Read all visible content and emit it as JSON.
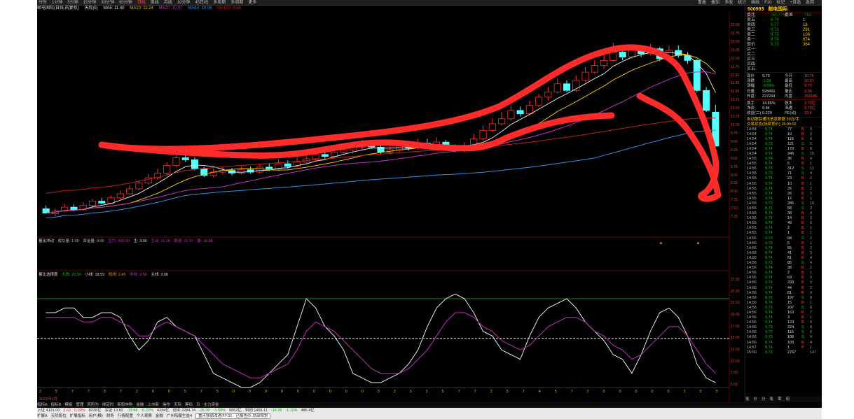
{
  "toolbar": {
    "period_tabs": [
      "分时",
      "1分钟",
      "5分钟",
      "15分钟",
      "30分钟",
      "60分钟",
      "日线",
      "周线",
      "月线",
      "10分钟",
      "45日线",
      "多周期",
      "多周期",
      "更多"
    ],
    "selected_period": "日线",
    "right_tools": [
      "重叠",
      "叠加",
      "多股",
      "统计",
      "画线",
      "F10",
      "标记",
      "+自选",
      "返回"
    ]
  },
  "info_row": {
    "stock": "邮电国际(日线,前复权)",
    "ma_label": "天际(5)",
    "items": [
      "MA5: 11.40",
      "MA10: 11.24",
      "MA20: 10.97",
      "MA60: 10.08",
      "MA120: 9.95"
    ]
  },
  "price_axis": [
    "13.00",
    "12.75",
    "12.50",
    "12.25",
    "12.00",
    "11.75",
    "11.50",
    "11.25",
    "11.00",
    "10.75",
    "10.50",
    "10.25",
    "10.00",
    "9.75",
    "9.50",
    "9.25",
    "9.00",
    "8.75",
    "8.50",
    "8.25",
    "8.00",
    "7.75",
    "7.50",
    "7.25"
  ],
  "indicator1": {
    "name": "量比冲动",
    "params": [
      "成交量: 1.00",
      "资金量: 0.00",
      "主力: 420.00",
      "主: 3.00",
      "主动: 11.18",
      "跟进: 11.70",
      "量: 18.88"
    ]
  },
  "indicator2": {
    "name": "量比选择度",
    "params": [
      "大线: 20.00",
      "小线: 18.59",
      "短线: 2.45",
      "中线: 9.66",
      "主线: 3.00"
    ]
  },
  "ind_axis": [
    "27.50",
    "25.00",
    "22.50",
    "20.00",
    "17.50",
    "15.00",
    "12.50",
    "10.00",
    "7.50",
    "5.00"
  ],
  "xaxis_values": "2 5 7 7 5 7 2 0 0 5 7 5 0 0 0 0 0 0 0 0 0 5 2 5 2 5 7 7 2 5 7 4 5 7 2 0 0 0 0 0 2 0 5 7 0 2 0 2 0 2 7 0 0 0 0 0 0 7 0 2 0 0 5 0 0 0 6 2 0 0 0 0",
  "xaxis_date": "2023年1月",
  "bottom_tabs": [
    "指标A",
    "指标B",
    "模板",
    "管理",
    "风险为",
    "绑定时",
    "新股申购",
    "金融",
    "上市新",
    "操作",
    "天际",
    "筹码",
    "日",
    "主力资金"
  ],
  "status_bar": {
    "row1": [
      "上证 4131.00",
      "3.62",
      "0.09%",
      "8226亿",
      "深证 13.82",
      "-13.48",
      "-0.22%",
      "4334亿",
      "创业 2284.74",
      "-35.00",
      "-1.08%",
      "5652亿",
      "科创 1455.11",
      "-16.39",
      "-1.11%",
      "486.4亿"
    ],
    "row2": [
      "扩展A",
      "天阶段位",
      "扩展指标",
      "用户(模)",
      "财务",
      "行情配置",
      "个人观察",
      "金融",
      "广州院服生益4"
    ],
    "input_text": "重点强调改进/FY.01 · 已报告价·总部规划"
  },
  "right_panel": {
    "stock_code": "600993",
    "stock_name": "邮电国际",
    "webi": {
      "label": "委比",
      "value": "-50.77%",
      "label2": "委差",
      "value2": "-782"
    },
    "sells": [
      {
        "label": "卖五",
        "price": "9.78",
        "vol": "1"
      },
      {
        "label": "卖四",
        "price": "9.77",
        "vol": "18"
      },
      {
        "label": "卖三",
        "price": "9.76",
        "vol": "291"
      },
      {
        "label": "卖二",
        "price": "9.75",
        "vol": "108"
      },
      {
        "label": "卖一",
        "price": "9.74",
        "vol": "674"
      }
    ],
    "current": {
      "label": "现价",
      "price": "9.73",
      "vol": "364"
    },
    "buys": [
      {
        "label": "买一",
        "price": "",
        "vol": ""
      },
      {
        "label": "买二",
        "price": "",
        "vol": ""
      },
      {
        "label": "买三",
        "price": "",
        "vol": ""
      },
      {
        "label": "买四",
        "price": "",
        "vol": ""
      },
      {
        "label": "买五",
        "price": "",
        "vol": ""
      }
    ],
    "stats": [
      {
        "l1": "现价",
        "v1": "9.73",
        "l2": "今开",
        "v2": "10.75"
      },
      {
        "l1": "涨跌",
        "v1": "-1.08",
        "l2": "最高",
        "v2": "10.97"
      },
      {
        "l1": "涨幅",
        "v1": "-9.99%",
        "l2": "最低",
        "v2": "9.73"
      },
      {
        "l1": "总量",
        "v1": "528460",
        "l2": "量比",
        "v2": "3.09"
      },
      {
        "l1": "外盘",
        "v1": "227234",
        "l2": "内盘",
        "v2": "293186"
      }
    ],
    "stats2": [
      {
        "l1": "换手",
        "v1": "14.86%",
        "l2": "股本",
        "v2": "3.70亿"
      },
      {
        "l1": "净资",
        "v1": "9.84",
        "l2": "流通",
        "v2": "3.70亿"
      },
      {
        "l1": "收益(二)",
        "v1": "0.220",
        "l2": "PE(动)",
        "v2": "33.4"
      }
    ],
    "fund_line1": "自动跟踪通讯信息数据 30万/手",
    "fund_line2": "交易状态(持续竞价) 15:00:02",
    "ticks": [
      {
        "t": "14:54",
        "p": "9.74",
        "v": "77",
        "d": "B",
        "n": "3"
      },
      {
        "t": "14:54",
        "p": "9.74",
        "v": "10",
        "d": "B",
        "n": "2"
      },
      {
        "t": "14:54",
        "p": "9.74",
        "v": "118",
        "d": "B",
        "n": "6"
      },
      {
        "t": "14:54",
        "p": "9.73",
        "v": "121",
        "d": "S",
        "n": "5"
      },
      {
        "t": "14:54",
        "p": "9.74",
        "v": "170",
        "d": "B",
        "n": "8"
      },
      {
        "t": "14:54",
        "p": "9.74",
        "v": "346",
        "d": "S",
        "n": "15"
      },
      {
        "t": "14:55",
        "p": "9.74",
        "v": "36",
        "d": "B",
        "n": "4"
      },
      {
        "t": "14:55",
        "p": "9.74",
        "v": "5",
        "d": "B",
        "n": "1"
      },
      {
        "t": "14:55",
        "p": "9.73",
        "v": "312",
        "d": "S",
        "n": "11"
      },
      {
        "t": "14:55",
        "p": "9.73",
        "v": "71",
        "d": "S",
        "n": "4"
      },
      {
        "t": "14:55",
        "p": "9.74",
        "v": "23",
        "d": "B",
        "n": "2"
      },
      {
        "t": "14:55",
        "p": "9.74",
        "v": "10",
        "d": "B",
        "n": "1"
      },
      {
        "t": "14:55",
        "p": "9.74",
        "v": "25",
        "d": "B",
        "n": "2"
      },
      {
        "t": "14:55",
        "p": "9.74",
        "v": "26",
        "d": "B",
        "n": "2"
      },
      {
        "t": "14:55",
        "p": "9.74",
        "v": "12",
        "d": "B",
        "n": "1"
      },
      {
        "t": "14:55",
        "p": "9.73",
        "v": "285",
        "d": "S",
        "n": "10"
      },
      {
        "t": "14:55",
        "p": "9.73",
        "v": "58",
        "d": "S",
        "n": "3"
      },
      {
        "t": "14:55",
        "p": "9.74",
        "v": "38",
        "d": "B",
        "n": "4"
      },
      {
        "t": "14:55",
        "p": "9.74",
        "v": "14",
        "d": "B",
        "n": "2"
      },
      {
        "t": "14:55",
        "p": "9.74",
        "v": "49",
        "d": "B",
        "n": "6"
      },
      {
        "t": "14:55",
        "p": "9.74",
        "v": "2",
        "d": "B",
        "n": "1"
      },
      {
        "t": "14:55",
        "p": "9.74",
        "v": "1",
        "d": "B",
        "n": "1"
      },
      {
        "t": "14:56",
        "p": "9.73",
        "v": "84",
        "d": "S",
        "n": "2"
      },
      {
        "t": "14:56",
        "p": "9.73",
        "v": "5",
        "d": "B",
        "n": "1"
      },
      {
        "t": "14:56",
        "p": "9.74",
        "v": "55",
        "d": "B",
        "n": "2"
      },
      {
        "t": "14:56",
        "p": "9.74",
        "v": "41",
        "d": "B",
        "n": "3"
      },
      {
        "t": "14:56",
        "p": "9.74",
        "v": "61",
        "d": "B",
        "n": "4"
      },
      {
        "t": "14:56",
        "p": "9.73",
        "v": "85",
        "d": "S",
        "n": "4"
      },
      {
        "t": "14:56",
        "p": "9.74",
        "v": "38",
        "d": "B",
        "n": "2"
      },
      {
        "t": "14:56",
        "p": "9.74",
        "v": "2",
        "d": "B",
        "n": "1"
      },
      {
        "t": "14:56",
        "p": "9.74",
        "v": "63",
        "d": "B",
        "n": "3"
      },
      {
        "t": "14:56",
        "p": "9.74",
        "v": "293",
        "d": "B",
        "n": "9"
      },
      {
        "t": "14:56",
        "p": "9.74",
        "v": "44",
        "d": "B",
        "n": "2"
      },
      {
        "t": "14:56",
        "p": "9.74",
        "v": "81",
        "d": "B",
        "n": "4"
      },
      {
        "t": "14:56",
        "p": "9.73",
        "v": "197",
        "d": "S",
        "n": "8"
      },
      {
        "t": "14:56",
        "p": "9.74",
        "v": "15",
        "d": "B",
        "n": "1"
      },
      {
        "t": "14:56",
        "p": "9.73",
        "v": "207",
        "d": "S",
        "n": "6"
      },
      {
        "t": "14:56",
        "p": "9.74",
        "v": "163",
        "d": "B",
        "n": "7"
      },
      {
        "t": "14:56",
        "p": "9.74",
        "v": "3",
        "d": "B",
        "n": "1"
      },
      {
        "t": "14:56",
        "p": "9.74",
        "v": "123",
        "d": "B",
        "n": "6"
      },
      {
        "t": "14:56",
        "p": "9.73",
        "v": "224",
        "d": "S",
        "n": "8"
      },
      {
        "t": "14:56",
        "p": "9.73",
        "v": "115",
        "d": "S",
        "n": "6"
      },
      {
        "t": "14:56",
        "p": "9.73",
        "v": "108",
        "d": "S",
        "n": "4"
      },
      {
        "t": "14:56",
        "p": "9.74",
        "v": "109",
        "d": "B",
        "n": "4"
      },
      {
        "t": "14:57",
        "p": "9.74",
        "v": "1",
        "d": "B",
        "n": "1"
      },
      {
        "t": "15:00",
        "p": "9.73",
        "v": "2767",
        "d": "",
        "n": "147"
      }
    ],
    "bottom": [
      "笔",
      "价",
      "分",
      "笔",
      "筹",
      "组"
    ]
  },
  "chart_data": [
    {
      "type": "candlestick",
      "title": "邮电国际(日线,前复权)",
      "ylim": [
        7.0,
        13.4
      ],
      "candles": [
        [
          7.85,
          7.72,
          7.95,
          7.7
        ],
        [
          7.7,
          7.78,
          7.85,
          7.62
        ],
        [
          7.78,
          7.9,
          8.0,
          7.75
        ],
        [
          7.9,
          7.82,
          7.98,
          7.78
        ],
        [
          7.82,
          7.95,
          8.05,
          7.8
        ],
        [
          7.95,
          8.08,
          8.15,
          7.92
        ],
        [
          8.08,
          8.02,
          8.18,
          7.98
        ],
        [
          8.02,
          8.18,
          8.25,
          8.0
        ],
        [
          8.18,
          8.3,
          8.4,
          8.12
        ],
        [
          8.3,
          8.45,
          8.55,
          8.28
        ],
        [
          8.45,
          8.62,
          8.7,
          8.4
        ],
        [
          8.62,
          8.78,
          8.9,
          8.58
        ],
        [
          8.78,
          8.92,
          9.05,
          8.72
        ],
        [
          8.92,
          9.15,
          9.25,
          8.85
        ],
        [
          9.15,
          9.38,
          9.45,
          9.1
        ],
        [
          9.38,
          9.32,
          9.5,
          9.25
        ],
        [
          9.32,
          9.05,
          9.4,
          9.0
        ],
        [
          9.05,
          8.85,
          9.1,
          8.8
        ],
        [
          8.85,
          8.95,
          9.05,
          8.8
        ],
        [
          8.95,
          9.0,
          9.1,
          8.88
        ],
        [
          9.0,
          8.92,
          9.08,
          8.85
        ],
        [
          8.92,
          9.02,
          9.12,
          8.88
        ],
        [
          9.02,
          8.95,
          9.12,
          8.9
        ],
        [
          8.95,
          9.1,
          9.2,
          8.9
        ],
        [
          9.1,
          9.05,
          9.22,
          8.98
        ],
        [
          9.05,
          9.2,
          9.35,
          9.0
        ],
        [
          9.2,
          9.12,
          9.3,
          9.05
        ],
        [
          9.12,
          9.25,
          9.4,
          9.1
        ],
        [
          9.25,
          9.35,
          9.48,
          9.18
        ],
        [
          9.35,
          9.48,
          9.6,
          9.3
        ],
        [
          9.48,
          9.42,
          9.6,
          9.35
        ],
        [
          9.42,
          9.55,
          9.68,
          9.38
        ],
        [
          9.55,
          9.62,
          9.75,
          9.48
        ],
        [
          9.62,
          9.7,
          9.85,
          9.55
        ],
        [
          9.7,
          9.78,
          9.92,
          9.62
        ],
        [
          9.78,
          9.7,
          9.92,
          9.65
        ],
        [
          9.7,
          9.55,
          9.78,
          9.5
        ],
        [
          9.55,
          9.62,
          9.72,
          9.48
        ],
        [
          9.62,
          9.75,
          9.88,
          9.55
        ],
        [
          9.75,
          9.68,
          9.85,
          9.6
        ],
        [
          9.68,
          9.82,
          9.95,
          9.62
        ],
        [
          9.82,
          9.75,
          9.95,
          9.7
        ],
        [
          9.75,
          9.85,
          10.0,
          9.7
        ],
        [
          9.85,
          9.72,
          9.92,
          9.68
        ],
        [
          9.72,
          9.6,
          9.78,
          9.55
        ],
        [
          9.6,
          9.75,
          9.85,
          9.55
        ],
        [
          9.75,
          9.95,
          10.1,
          9.7
        ],
        [
          9.95,
          10.2,
          10.35,
          9.9
        ],
        [
          10.2,
          10.4,
          10.55,
          10.15
        ],
        [
          10.4,
          10.55,
          10.75,
          10.35
        ],
        [
          10.55,
          10.8,
          10.95,
          10.5
        ],
        [
          10.8,
          10.7,
          10.92,
          10.62
        ],
        [
          10.7,
          10.95,
          11.1,
          10.65
        ],
        [
          10.95,
          11.2,
          11.3,
          10.9
        ],
        [
          11.2,
          11.35,
          11.5,
          11.1
        ],
        [
          11.35,
          11.6,
          11.75,
          11.3
        ],
        [
          11.6,
          11.4,
          11.7,
          11.35
        ],
        [
          11.4,
          11.7,
          11.85,
          11.35
        ],
        [
          11.7,
          11.95,
          12.1,
          11.65
        ],
        [
          11.95,
          12.15,
          12.3,
          11.9
        ],
        [
          12.15,
          12.3,
          12.5,
          12.05
        ],
        [
          12.3,
          12.55,
          12.82,
          12.25
        ],
        [
          12.55,
          12.4,
          12.7,
          12.3
        ],
        [
          12.4,
          12.6,
          12.75,
          12.35
        ],
        [
          12.6,
          12.5,
          12.72,
          12.4
        ],
        [
          12.5,
          12.65,
          12.8,
          12.45
        ],
        [
          12.65,
          12.35,
          12.7,
          12.28
        ],
        [
          12.35,
          12.6,
          12.75,
          12.3
        ],
        [
          12.6,
          12.45,
          12.75,
          12.38
        ],
        [
          12.45,
          12.3,
          12.55,
          12.2
        ],
        [
          12.3,
          11.4,
          12.35,
          11.35
        ],
        [
          11.4,
          10.8,
          11.5,
          10.75
        ],
        [
          10.75,
          9.73,
          10.97,
          9.73
        ]
      ],
      "ma_series": [
        {
          "name": "MA5",
          "color": "#e0e0e0"
        },
        {
          "name": "MA10",
          "color": "#e8c000"
        },
        {
          "name": "MA20",
          "color": "#c030c0"
        },
        {
          "name": "MA60",
          "color": "#3090e0"
        },
        {
          "name": "MA120",
          "color": "#c02020"
        }
      ]
    },
    {
      "type": "line",
      "title": "量比选择度",
      "ylim": [
        5,
        27.5
      ],
      "series": [
        {
          "name": "大线",
          "values": [
            23,
            23,
            24,
            24,
            22,
            22,
            23,
            23,
            22,
            18,
            15,
            17,
            21,
            22,
            20,
            19,
            18,
            14,
            10,
            9,
            8,
            7,
            7,
            8,
            10,
            12,
            14,
            20,
            26,
            24,
            20,
            18,
            15,
            10,
            9,
            8,
            8,
            9,
            10,
            12,
            15,
            20,
            24,
            26,
            27,
            26,
            23,
            19,
            18,
            15,
            14,
            13,
            18,
            22,
            24,
            25,
            26,
            24,
            21,
            19,
            17,
            14,
            13,
            10,
            14,
            19,
            23,
            24,
            22,
            18,
            12,
            9,
            8
          ]
        },
        {
          "name": "中线",
          "values": [
            22,
            22,
            22,
            22,
            21,
            21,
            22,
            22,
            21,
            20,
            18,
            18,
            20,
            21,
            20,
            19,
            18,
            16,
            14,
            12,
            11,
            10,
            9,
            9,
            10,
            11,
            12,
            15,
            19,
            21,
            20,
            19,
            17,
            15,
            13,
            11,
            10,
            10,
            10,
            11,
            13,
            15,
            18,
            21,
            23,
            23,
            22,
            20,
            19,
            17,
            16,
            15,
            16,
            18,
            20,
            21,
            22,
            22,
            21,
            19,
            18,
            16,
            15,
            13,
            14,
            16,
            18,
            20,
            20,
            18,
            15,
            12,
            10
          ]
        }
      ]
    }
  ]
}
